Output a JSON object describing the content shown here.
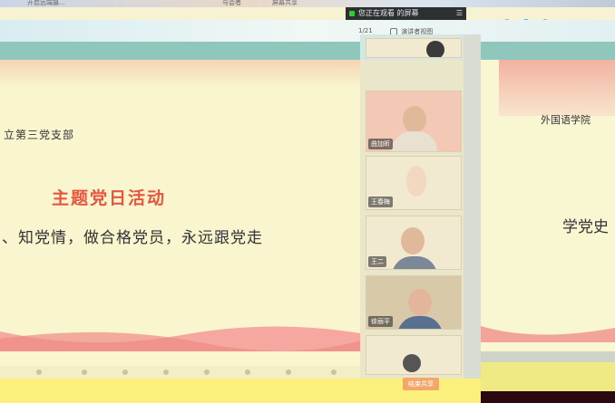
{
  "topbar": {
    "items": [
      "开启远端摄...",
      "与会者",
      "屏幕共享"
    ]
  },
  "notice": {
    "text": "您正在观看 的屏幕",
    "menu": "☰"
  },
  "toolbar": {
    "left_label": "1/21",
    "view_label": "演讲者视图"
  },
  "slide": {
    "header": "立第三党支部",
    "title": "主题党日活动",
    "slogan": "、知党情，做合格党员，永远跟党走"
  },
  "preview": {
    "header": "外国语学院",
    "big_text": "学党史"
  },
  "participants": [
    {
      "name": "曲加昕"
    },
    {
      "name": "王春梅"
    },
    {
      "name": "王二"
    },
    {
      "name": "徐丽平"
    }
  ],
  "controls": {
    "end_label": "结束共享"
  },
  "colors": {
    "title_red": "#e8553f",
    "accent_blue": "#35a9e6"
  }
}
